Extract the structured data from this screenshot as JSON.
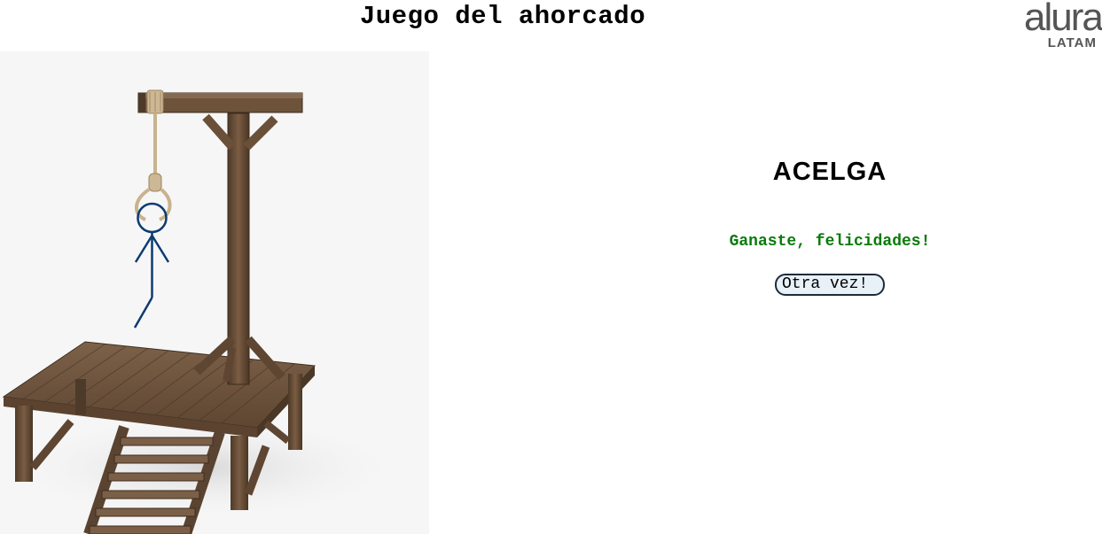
{
  "header": {
    "title": "Juego del ahorcado"
  },
  "logo": {
    "main": "alura",
    "sub": "LATAM"
  },
  "game": {
    "word": "ACELGA",
    "status_message": "Ganaste, felicidades!",
    "status_color": "#0a7a0a",
    "restart_label": "Otra vez!",
    "stick_figure_color": "#0d3b73"
  }
}
